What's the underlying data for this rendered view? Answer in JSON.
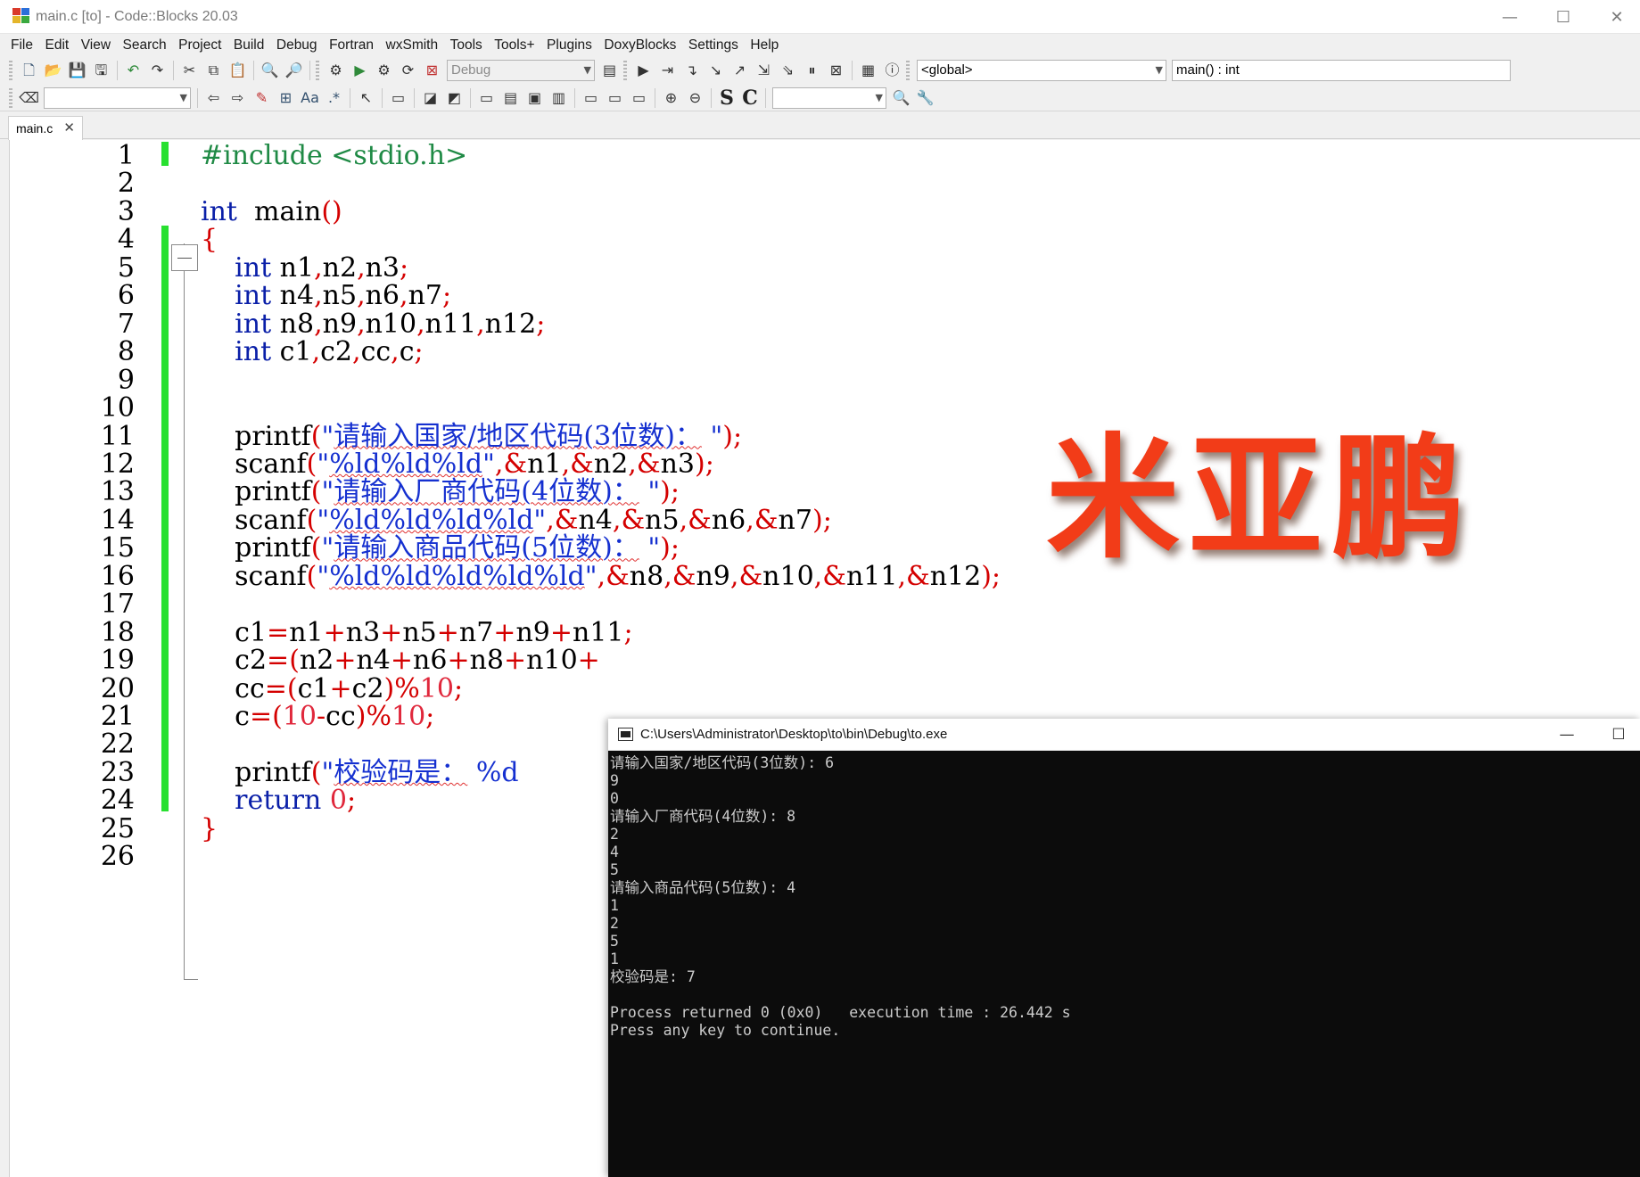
{
  "window": {
    "title": "main.c [to] - Code::Blocks 20.03",
    "minimize": "—",
    "maximize": "☐",
    "close": "✕"
  },
  "menu": [
    "File",
    "Edit",
    "View",
    "Search",
    "Project",
    "Build",
    "Debug",
    "Fortran",
    "wxSmith",
    "Tools",
    "Tools+",
    "Plugins",
    "DoxyBlocks",
    "Settings",
    "Help"
  ],
  "toolbar": {
    "build_target": "Debug",
    "scope": "<global>",
    "function": "main() : int",
    "search_text": "",
    "search_text2": "",
    "letter_s": "S",
    "letter_c": "C"
  },
  "tab": {
    "label": "main.c",
    "close": "✕"
  },
  "editor": {
    "line_numbers": [
      "1",
      "2",
      "3",
      "4",
      "5",
      "6",
      "7",
      "8",
      "9",
      "10",
      "11",
      "12",
      "13",
      "14",
      "15",
      "16",
      "17",
      "18",
      "19",
      "20",
      "21",
      "22",
      "23",
      "24",
      "25",
      "26"
    ],
    "lines": {
      "l1": [
        [
          "pp",
          "#include <stdio.h>"
        ]
      ],
      "l3": [
        [
          "kw",
          "int"
        ],
        [
          "",
          "  main"
        ],
        [
          "op",
          "()"
        ]
      ],
      "l4": [
        [
          "op",
          "{"
        ]
      ],
      "l5": [
        [
          "",
          "    "
        ],
        [
          "kw",
          "int"
        ],
        [
          "",
          " n1"
        ],
        [
          "op",
          ","
        ],
        [
          "",
          "n2"
        ],
        [
          "op",
          ","
        ],
        [
          "",
          "n3"
        ],
        [
          "op",
          ";"
        ]
      ],
      "l6": [
        [
          "",
          "    "
        ],
        [
          "kw",
          "int"
        ],
        [
          "",
          " n4"
        ],
        [
          "op",
          ","
        ],
        [
          "",
          "n5"
        ],
        [
          "op",
          ","
        ],
        [
          "",
          "n6"
        ],
        [
          "op",
          ","
        ],
        [
          "",
          "n7"
        ],
        [
          "op",
          ";"
        ]
      ],
      "l7": [
        [
          "",
          "    "
        ],
        [
          "kw",
          "int"
        ],
        [
          "",
          " n8"
        ],
        [
          "op",
          ","
        ],
        [
          "",
          "n9"
        ],
        [
          "op",
          ","
        ],
        [
          "",
          "n10"
        ],
        [
          "op",
          ","
        ],
        [
          "",
          "n11"
        ],
        [
          "op",
          ","
        ],
        [
          "",
          "n12"
        ],
        [
          "op",
          ";"
        ]
      ],
      "l8": [
        [
          "",
          "    "
        ],
        [
          "kw",
          "int"
        ],
        [
          "",
          " c1"
        ],
        [
          "op",
          ","
        ],
        [
          "",
          "c2"
        ],
        [
          "op",
          ","
        ],
        [
          "",
          "cc"
        ],
        [
          "op",
          ","
        ],
        [
          "",
          "c"
        ],
        [
          "op",
          ";"
        ]
      ],
      "l11": [
        [
          "",
          "    printf"
        ],
        [
          "op",
          "("
        ],
        [
          "str",
          "\""
        ],
        [
          "chs",
          "请输入国家/地区代码(3位数)："
        ],
        [
          "str",
          " \""
        ],
        [
          "op",
          ")"
        ],
        [
          "op",
          ";"
        ]
      ],
      "l12": [
        [
          "",
          "    scanf"
        ],
        [
          "op",
          "("
        ],
        [
          "str",
          "\""
        ],
        [
          "chs",
          "%ld%ld%ld"
        ],
        [
          "str",
          "\""
        ],
        [
          "op",
          ","
        ],
        [
          "op",
          "&"
        ],
        [
          "",
          "n1"
        ],
        [
          "op",
          ","
        ],
        [
          "op",
          "&"
        ],
        [
          "",
          "n2"
        ],
        [
          "op",
          ","
        ],
        [
          "op",
          "&"
        ],
        [
          "",
          "n3"
        ],
        [
          "op",
          ")"
        ],
        [
          "op",
          ";"
        ]
      ],
      "l13": [
        [
          "",
          "    printf"
        ],
        [
          "op",
          "("
        ],
        [
          "str",
          "\""
        ],
        [
          "chs",
          "请输入厂商代码(4位数)："
        ],
        [
          "str",
          " \""
        ],
        [
          "op",
          ")"
        ],
        [
          "op",
          ";"
        ]
      ],
      "l14": [
        [
          "",
          "    scanf"
        ],
        [
          "op",
          "("
        ],
        [
          "str",
          "\""
        ],
        [
          "chs",
          "%ld%ld%ld%ld"
        ],
        [
          "str",
          "\""
        ],
        [
          "op",
          ","
        ],
        [
          "op",
          "&"
        ],
        [
          "",
          "n4"
        ],
        [
          "op",
          ","
        ],
        [
          "op",
          "&"
        ],
        [
          "",
          "n5"
        ],
        [
          "op",
          ","
        ],
        [
          "op",
          "&"
        ],
        [
          "",
          "n6"
        ],
        [
          "op",
          ","
        ],
        [
          "op",
          "&"
        ],
        [
          "",
          "n7"
        ],
        [
          "op",
          ")"
        ],
        [
          "op",
          ";"
        ]
      ],
      "l15": [
        [
          "",
          "    printf"
        ],
        [
          "op",
          "("
        ],
        [
          "str",
          "\""
        ],
        [
          "chs",
          "请输入商品代码(5位数)："
        ],
        [
          "str",
          " \""
        ],
        [
          "op",
          ")"
        ],
        [
          "op",
          ";"
        ]
      ],
      "l16": [
        [
          "",
          "    scanf"
        ],
        [
          "op",
          "("
        ],
        [
          "str",
          "\""
        ],
        [
          "chs",
          "%ld%ld%ld%ld%ld"
        ],
        [
          "str",
          "\""
        ],
        [
          "op",
          ","
        ],
        [
          "op",
          "&"
        ],
        [
          "",
          "n8"
        ],
        [
          "op",
          ","
        ],
        [
          "op",
          "&"
        ],
        [
          "",
          "n9"
        ],
        [
          "op",
          ","
        ],
        [
          "op",
          "&"
        ],
        [
          "",
          "n10"
        ],
        [
          "op",
          ","
        ],
        [
          "op",
          "&"
        ],
        [
          "",
          "n11"
        ],
        [
          "op",
          ","
        ],
        [
          "op",
          "&"
        ],
        [
          "",
          "n12"
        ],
        [
          "op",
          ")"
        ],
        [
          "op",
          ";"
        ]
      ],
      "l18": [
        [
          "",
          "    c1"
        ],
        [
          "op",
          "="
        ],
        [
          "",
          "n1"
        ],
        [
          "op",
          "+"
        ],
        [
          "",
          "n3"
        ],
        [
          "op",
          "+"
        ],
        [
          "",
          "n5"
        ],
        [
          "op",
          "+"
        ],
        [
          "",
          "n7"
        ],
        [
          "op",
          "+"
        ],
        [
          "",
          "n9"
        ],
        [
          "op",
          "+"
        ],
        [
          "",
          "n11"
        ],
        [
          "op",
          ";"
        ]
      ],
      "l19": [
        [
          "",
          "    c2"
        ],
        [
          "op",
          "="
        ],
        [
          "op",
          "("
        ],
        [
          "",
          "n2"
        ],
        [
          "op",
          "+"
        ],
        [
          "",
          "n4"
        ],
        [
          "op",
          "+"
        ],
        [
          "",
          "n6"
        ],
        [
          "op",
          "+"
        ],
        [
          "",
          "n8"
        ],
        [
          "op",
          "+"
        ],
        [
          "",
          "n10"
        ],
        [
          "op",
          "+"
        ]
      ],
      "l20": [
        [
          "",
          "    cc"
        ],
        [
          "op",
          "="
        ],
        [
          "op",
          "("
        ],
        [
          "",
          "c1"
        ],
        [
          "op",
          "+"
        ],
        [
          "",
          "c2"
        ],
        [
          "op",
          ")"
        ],
        [
          "op",
          "%"
        ],
        [
          "num",
          "10"
        ],
        [
          "op",
          ";"
        ]
      ],
      "l21": [
        [
          "",
          "    c"
        ],
        [
          "op",
          "="
        ],
        [
          "op",
          "("
        ],
        [
          "num",
          "10"
        ],
        [
          "op",
          "-"
        ],
        [
          "",
          "cc"
        ],
        [
          "op",
          ")"
        ],
        [
          "op",
          "%"
        ],
        [
          "num",
          "10"
        ],
        [
          "op",
          ";"
        ]
      ],
      "l23": [
        [
          "",
          "    printf"
        ],
        [
          "op",
          "("
        ],
        [
          "str",
          "\""
        ],
        [
          "chs",
          "校验码是："
        ],
        [
          "str",
          " %d"
        ]
      ],
      "l24": [
        [
          "",
          "    "
        ],
        [
          "kw",
          "return"
        ],
        [
          "",
          " "
        ],
        [
          "num",
          "0"
        ],
        [
          "op",
          ";"
        ]
      ],
      "l25": [
        [
          "op",
          "}"
        ]
      ]
    }
  },
  "watermark": {
    "text": "米亚鹏"
  },
  "console": {
    "title": "C:\\Users\\Administrator\\Desktop\\to\\bin\\Debug\\to.exe",
    "minimize": "—",
    "maximize": "☐",
    "lines": [
      "请输入国家/地区代码(3位数): 6",
      "9",
      "0",
      "请输入厂商代码(4位数): 8",
      "2",
      "4",
      "5",
      "请输入商品代码(5位数): 4",
      "1",
      "2",
      "5",
      "1",
      "校验码是: 7",
      "",
      "Process returned 0 (0x0)   execution time : 26.442 s",
      "Press any key to continue."
    ]
  }
}
